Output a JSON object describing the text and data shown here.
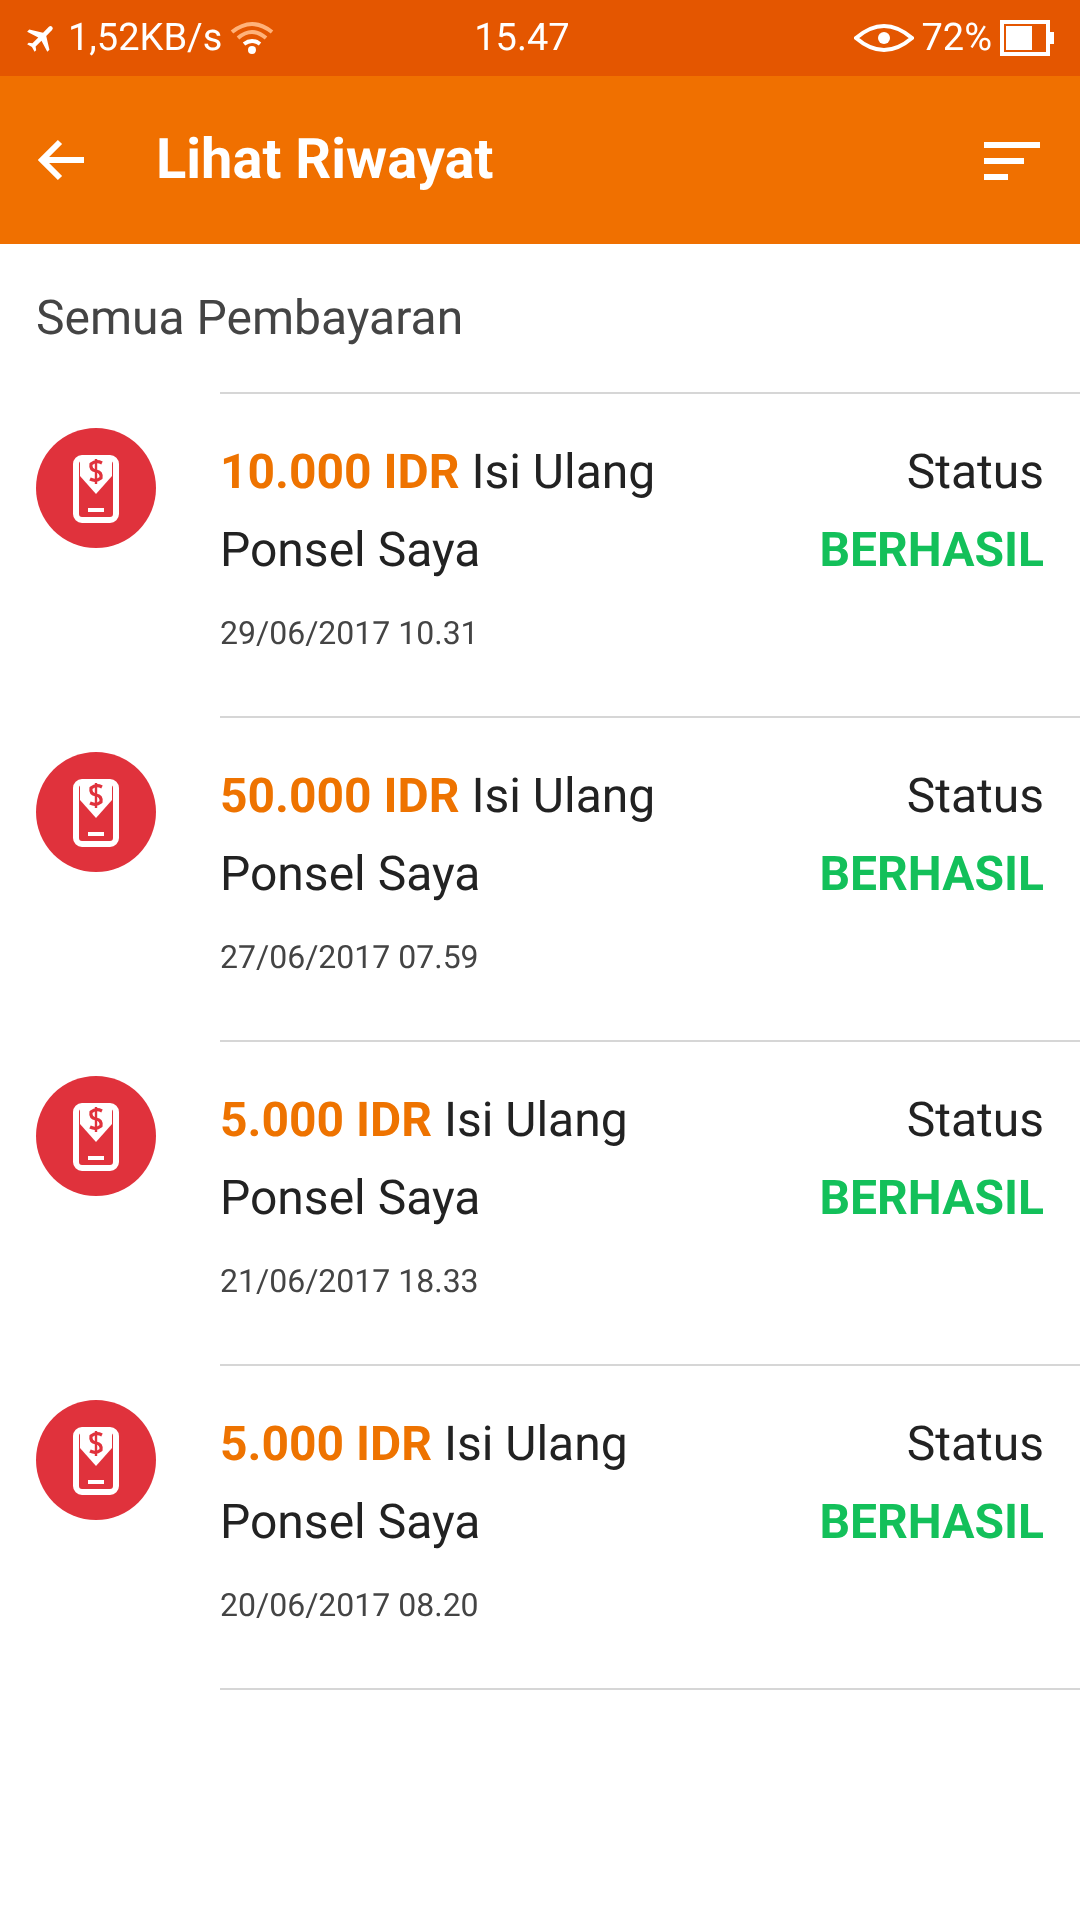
{
  "status_bar": {
    "speed": "1,52KB/s",
    "time": "15.47",
    "battery": "72%"
  },
  "app_bar": {
    "title": "Lihat Riwayat"
  },
  "section_title": "Semua Pembayaran",
  "transactions": [
    {
      "amount": "10.000 IDR",
      "description": "Isi Ulang Ponsel Saya",
      "date": "29/06/2017 10.31",
      "status_label": "Status",
      "status": "BERHASIL"
    },
    {
      "amount": "50.000 IDR",
      "description": "Isi Ulang Ponsel Saya",
      "date": "27/06/2017 07.59",
      "status_label": "Status",
      "status": "BERHASIL"
    },
    {
      "amount": "5.000 IDR",
      "description": "Isi Ulang Ponsel Saya",
      "date": "21/06/2017 18.33",
      "status_label": "Status",
      "status": "BERHASIL"
    },
    {
      "amount": "5.000 IDR",
      "description": "Isi Ulang Ponsel Saya",
      "date": "20/06/2017 08.20",
      "status_label": "Status",
      "status": "BERHASIL"
    }
  ]
}
